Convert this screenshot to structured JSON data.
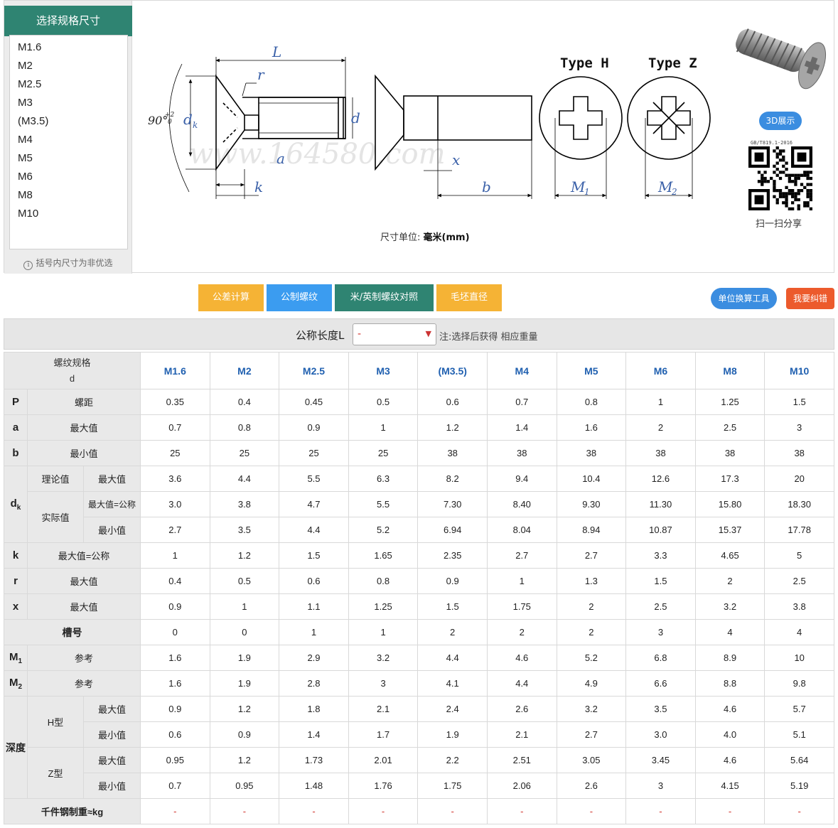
{
  "sidebar": {
    "title": "选择规格尺寸",
    "specs": [
      "M1.6",
      "M2",
      "M2.5",
      "M3",
      "(M3.5)",
      "M4",
      "M5",
      "M6",
      "M8",
      "M10"
    ],
    "note": "括号内尺寸为非优选"
  },
  "drawing": {
    "labels": {
      "L": "L",
      "r": "r",
      "dk": "d",
      "dk_sub": "k",
      "angle": "90°",
      "angle_tol": "+2",
      "angle_tol2": "0",
      "d": "d",
      "a": "a",
      "k": "k",
      "x": "x",
      "b": "b",
      "typeH": "Type H",
      "typeZ": "Type Z",
      "M1": "M",
      "M1_sub": "1",
      "M2": "M",
      "M2_sub": "2",
      "watermark": "www.164580.com"
    },
    "unit_prefix": "尺寸单位:",
    "unit_value": "毫米(mm)"
  },
  "side_right": {
    "btn_3d": "3D展示",
    "standard": "GB/T819.1-2016",
    "share": "扫一扫分享"
  },
  "buttons": {
    "tolerance": "公差计算",
    "metric": "公制螺纹",
    "convert": "米/英制螺纹对照",
    "blank": "毛坯直径",
    "unit_tool": "单位换算工具",
    "report": "我要纠错"
  },
  "length": {
    "label": "公称长度L",
    "selected": "-",
    "note": "注:选择后获得 相应重量"
  },
  "table": {
    "corner_line1": "螺纹规格",
    "corner_line2": "d",
    "columns": [
      "M1.6",
      "M2",
      "M2.5",
      "M3",
      "(M3.5)",
      "M4",
      "M5",
      "M6",
      "M8",
      "M10"
    ],
    "labels": {
      "P": "P",
      "pitch": "螺距",
      "a": "a",
      "max": "最大值",
      "b": "b",
      "min": "最小值",
      "dk": "d",
      "dk_sub": "k",
      "theory": "理论值",
      "actual": "实际值",
      "max_nominal": "最大值=公称",
      "k": "k",
      "r": "r",
      "x": "x",
      "slot": "槽号",
      "M1": "M",
      "M1_sub": "1",
      "M2": "M",
      "M2_sub": "2",
      "ref": "参考",
      "depth": "深度",
      "H": "H型",
      "Z": "Z型",
      "weight": "千件钢制重≈kg"
    },
    "rows": {
      "P": [
        "0.35",
        "0.4",
        "0.45",
        "0.5",
        "0.6",
        "0.7",
        "0.8",
        "1",
        "1.25",
        "1.5"
      ],
      "a_max": [
        "0.7",
        "0.8",
        "0.9",
        "1",
        "1.2",
        "1.4",
        "1.6",
        "2",
        "2.5",
        "3"
      ],
      "b_min": [
        "25",
        "25",
        "25",
        "25",
        "38",
        "38",
        "38",
        "38",
        "38",
        "38"
      ],
      "dk_theory_max": [
        "3.6",
        "4.4",
        "5.5",
        "6.3",
        "8.2",
        "9.4",
        "10.4",
        "12.6",
        "17.3",
        "20"
      ],
      "dk_actual_max": [
        "3.0",
        "3.8",
        "4.7",
        "5.5",
        "7.30",
        "8.40",
        "9.30",
        "11.30",
        "15.80",
        "18.30"
      ],
      "dk_actual_min": [
        "2.7",
        "3.5",
        "4.4",
        "5.2",
        "6.94",
        "8.04",
        "8.94",
        "10.87",
        "15.37",
        "17.78"
      ],
      "k_max": [
        "1",
        "1.2",
        "1.5",
        "1.65",
        "2.35",
        "2.7",
        "2.7",
        "3.3",
        "4.65",
        "5"
      ],
      "r_max": [
        "0.4",
        "0.5",
        "0.6",
        "0.8",
        "0.9",
        "1",
        "1.3",
        "1.5",
        "2",
        "2.5"
      ],
      "x_max": [
        "0.9",
        "1",
        "1.1",
        "1.25",
        "1.5",
        "1.75",
        "2",
        "2.5",
        "3.2",
        "3.8"
      ],
      "slot": [
        "0",
        "0",
        "1",
        "1",
        "2",
        "2",
        "2",
        "3",
        "4",
        "4"
      ],
      "M1_ref": [
        "1.6",
        "1.9",
        "2.9",
        "3.2",
        "4.4",
        "4.6",
        "5.2",
        "6.8",
        "8.9",
        "10"
      ],
      "M2_ref": [
        "1.6",
        "1.9",
        "2.8",
        "3",
        "4.1",
        "4.4",
        "4.9",
        "6.6",
        "8.8",
        "9.8"
      ],
      "H_max": [
        "0.9",
        "1.2",
        "1.8",
        "2.1",
        "2.4",
        "2.6",
        "3.2",
        "3.5",
        "4.6",
        "5.7"
      ],
      "H_min": [
        "0.6",
        "0.9",
        "1.4",
        "1.7",
        "1.9",
        "2.1",
        "2.7",
        "3.0",
        "4.0",
        "5.1"
      ],
      "Z_max": [
        "0.95",
        "1.2",
        "1.73",
        "2.01",
        "2.2",
        "2.51",
        "3.05",
        "3.45",
        "4.6",
        "5.64"
      ],
      "Z_min": [
        "0.7",
        "0.95",
        "1.48",
        "1.76",
        "1.75",
        "2.06",
        "2.6",
        "3",
        "4.15",
        "5.19"
      ],
      "weight": [
        "-",
        "-",
        "-",
        "-",
        "-",
        "-",
        "-",
        "-",
        "-",
        "-"
      ]
    }
  },
  "colors": {
    "sidebar_head": "#2f8472",
    "btn_orange": "#f5b335",
    "btn_blue": "#3b9cf0",
    "btn_teal": "#2f8472",
    "pill_blue": "#3b8de0",
    "pill_red": "#ec5a2c",
    "column_header": "#2060b0",
    "dash": "#d0302a"
  }
}
